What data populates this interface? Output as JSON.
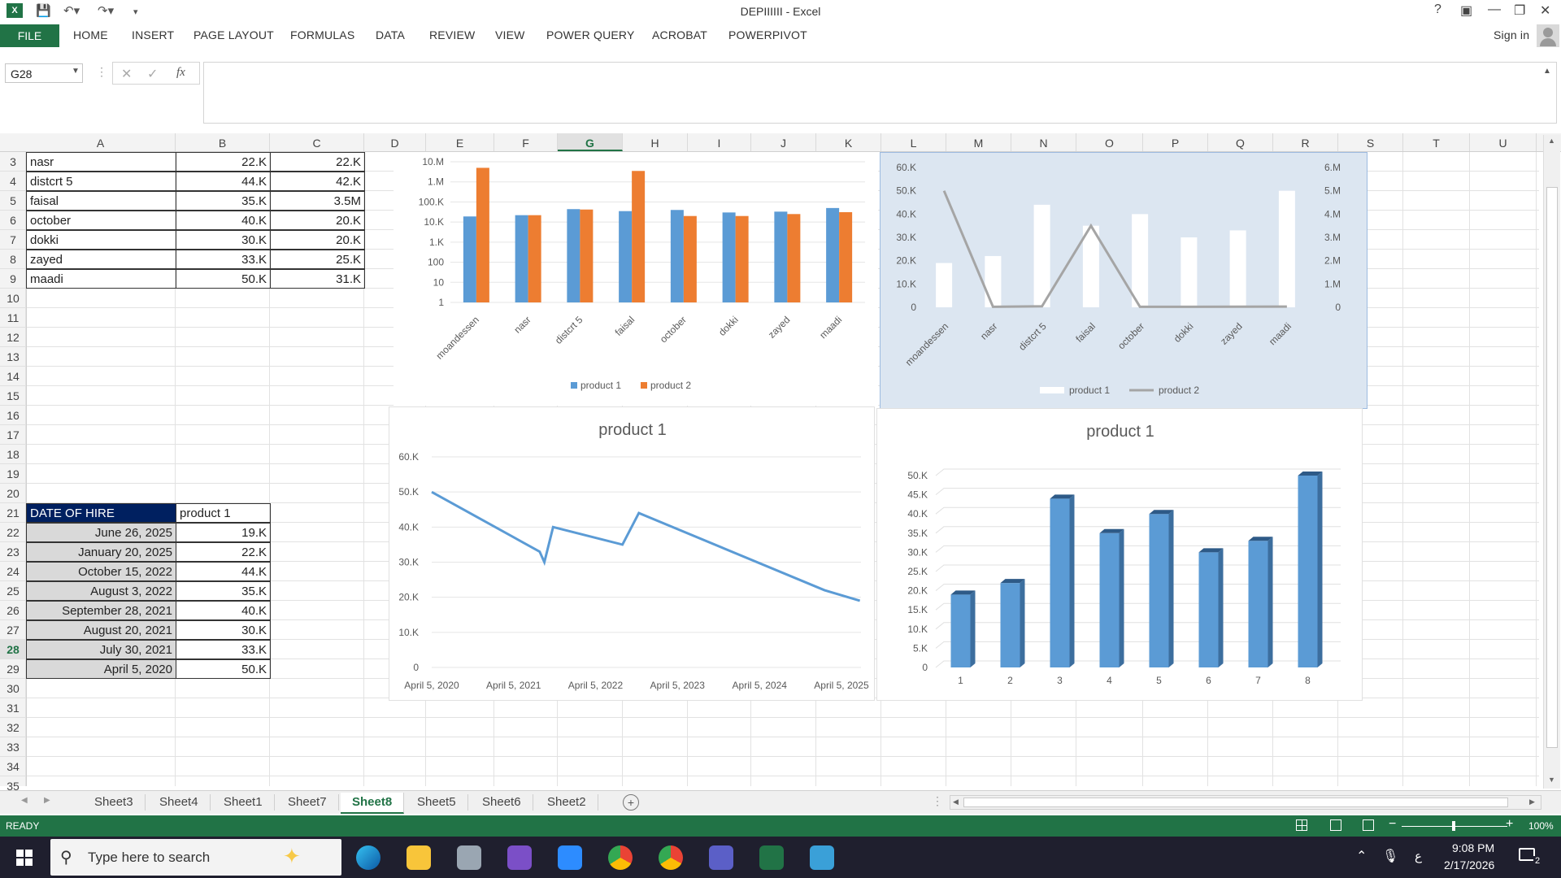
{
  "window": {
    "title": "DEPIIIIII - Excel",
    "help": "?",
    "sign_in": "Sign in"
  },
  "ribbon": {
    "file": "FILE",
    "tabs": [
      "HOME",
      "INSERT",
      "PAGE LAYOUT",
      "FORMULAS",
      "DATA",
      "REVIEW",
      "VIEW",
      "POWER QUERY",
      "ACROBAT",
      "POWERPIVOT"
    ]
  },
  "formula_bar": {
    "name_box": "G28",
    "fx": "fx",
    "value": ""
  },
  "columns": [
    "A",
    "B",
    "C",
    "D",
    "E",
    "F",
    "G",
    "H",
    "I",
    "J",
    "K",
    "L",
    "M",
    "N",
    "O",
    "P",
    "Q",
    "R",
    "S",
    "T",
    "U"
  ],
  "rows": [
    "3",
    "4",
    "5",
    "6",
    "7",
    "8",
    "9",
    "10",
    "11",
    "12",
    "13",
    "14",
    "15",
    "16",
    "17",
    "18",
    "19",
    "20",
    "21",
    "22",
    "23",
    "24",
    "25",
    "26",
    "27",
    "28",
    "29",
    "30",
    "31",
    "32",
    "33",
    "34",
    "35"
  ],
  "table1": [
    [
      "nasr",
      "22.K",
      "22.K"
    ],
    [
      "distcrt 5",
      "44.K",
      "42.K"
    ],
    [
      "faisal",
      "35.K",
      "3.5M"
    ],
    [
      "october",
      "40.K",
      "20.K"
    ],
    [
      "dokki",
      "30.K",
      "20.K"
    ],
    [
      "zayed",
      "33.K",
      "25.K"
    ],
    [
      "maadi",
      "50.K",
      "31.K"
    ]
  ],
  "table2": {
    "header": [
      "DATE OF HIRE",
      "product 1"
    ],
    "rows": [
      [
        "June 26, 2025",
        "19.K"
      ],
      [
        "January 20, 2025",
        "22.K"
      ],
      [
        "October 15, 2022",
        "44.K"
      ],
      [
        "August 3, 2022",
        "35.K"
      ],
      [
        "September 28, 2021",
        "40.K"
      ],
      [
        "August 20, 2021",
        "30.K"
      ],
      [
        "July 30, 2021",
        "33.K"
      ],
      [
        "April 5, 2020",
        "50.K"
      ]
    ]
  },
  "chart_data": [
    {
      "type": "bar",
      "title": "",
      "y_scale": "log",
      "yticks": [
        "10.M",
        "1.M",
        "100.K",
        "10.K",
        "1.K",
        "100",
        "10",
        "1"
      ],
      "categories": [
        "moandessen",
        "nasr",
        "distcrt 5",
        "faisal",
        "october",
        "dokki",
        "zayed",
        "maadi"
      ],
      "series": [
        {
          "name": "product 1",
          "color": "#5b9bd5",
          "values": [
            19000,
            22000,
            44000,
            35000,
            40000,
            30000,
            33000,
            50000
          ]
        },
        {
          "name": "product 2",
          "color": "#ed7d31",
          "values": [
            5000000,
            22000,
            42000,
            3500000,
            20000,
            20000,
            25000,
            31000
          ]
        }
      ],
      "legend": "bottom"
    },
    {
      "type": "bar",
      "title": "",
      "background": "#dce6f1",
      "yticks_left": [
        "60.K",
        "50.K",
        "40.K",
        "30.K",
        "20.K",
        "10.K",
        "0"
      ],
      "yticks_right": [
        "6.M",
        "5.M",
        "4.M",
        "3.M",
        "2.M",
        "1.M",
        "0"
      ],
      "ylim_left": [
        0,
        60000
      ],
      "ylim_right": [
        0,
        6000000
      ],
      "categories": [
        "moandessen",
        "nasr",
        "distcrt 5",
        "faisal",
        "october",
        "dokki",
        "zayed",
        "maadi"
      ],
      "series": [
        {
          "name": "product 1",
          "type": "bar",
          "axis": "left",
          "color": "#ffffff",
          "values": [
            19000,
            22000,
            44000,
            35000,
            40000,
            30000,
            33000,
            50000
          ]
        },
        {
          "name": "product 2",
          "type": "line",
          "axis": "right",
          "color": "#a5a5a5",
          "values": [
            5000000,
            22000,
            42000,
            3500000,
            20000,
            20000,
            25000,
            31000
          ]
        }
      ],
      "legend": "bottom"
    },
    {
      "type": "line",
      "title": "product 1",
      "yticks": [
        "60.K",
        "50.K",
        "40.K",
        "30.K",
        "20.K",
        "10.K",
        "0"
      ],
      "ylim": [
        0,
        60000
      ],
      "xticks": [
        "April 5, 2020",
        "April 5, 2021",
        "April 5, 2022",
        "April 5, 2023",
        "April 5, 2024",
        "April 5, 2025"
      ],
      "xlim": [
        "2020-04-05",
        "2025-07-01"
      ],
      "series": [
        {
          "name": "product 1",
          "color": "#5b9bd5",
          "x": [
            "2020-04-05",
            "2021-07-30",
            "2021-08-20",
            "2021-09-28",
            "2022-08-03",
            "2022-10-15",
            "2025-01-20",
            "2025-06-26"
          ],
          "values": [
            50000,
            33000,
            30000,
            40000,
            35000,
            44000,
            22000,
            19000
          ]
        }
      ]
    },
    {
      "type": "bar",
      "title": "product 1",
      "style": "3d-column",
      "yticks": [
        "50.K",
        "45.K",
        "40.K",
        "35.K",
        "30.K",
        "25.K",
        "20.K",
        "15.K",
        "10.K",
        "5.K",
        "0"
      ],
      "ylim": [
        0,
        50000
      ],
      "categories": [
        "1",
        "2",
        "3",
        "4",
        "5",
        "6",
        "7",
        "8"
      ],
      "series": [
        {
          "name": "product 1",
          "color": "#5b9bd5",
          "values": [
            19000,
            22000,
            44000,
            35000,
            40000,
            30000,
            33000,
            50000
          ]
        }
      ]
    }
  ],
  "sheet_tabs": [
    "Sheet3",
    "Sheet4",
    "Sheet1",
    "Sheet7",
    "Sheet8",
    "Sheet5",
    "Sheet6",
    "Sheet2"
  ],
  "active_sheet": "Sheet8",
  "status": {
    "mode": "READY",
    "zoom": "100%"
  },
  "taskbar": {
    "search_placeholder": "Type here to search",
    "time": "9:08 PM",
    "date": "2/17/2026",
    "lang": "ع",
    "notifications": "2"
  }
}
